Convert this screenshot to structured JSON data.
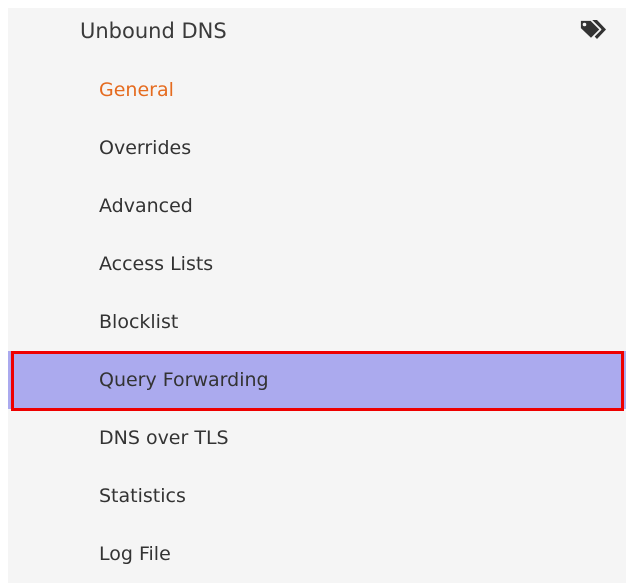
{
  "header": {
    "label": "Unbound DNS",
    "icon": "tags-icon"
  },
  "items": [
    {
      "label": "General",
      "state": "active"
    },
    {
      "label": "Overrides",
      "state": ""
    },
    {
      "label": "Advanced",
      "state": ""
    },
    {
      "label": "Access Lists",
      "state": ""
    },
    {
      "label": "Blocklist",
      "state": ""
    },
    {
      "label": "Query Forwarding",
      "state": "selected"
    },
    {
      "label": "DNS over TLS",
      "state": ""
    },
    {
      "label": "Statistics",
      "state": ""
    },
    {
      "label": "Log File",
      "state": ""
    }
  ],
  "colors": {
    "active_text": "#e56b1f",
    "selected_background": "#abaaee",
    "highlight_border": "#ee0000",
    "panel_background": "#f5f5f5"
  }
}
